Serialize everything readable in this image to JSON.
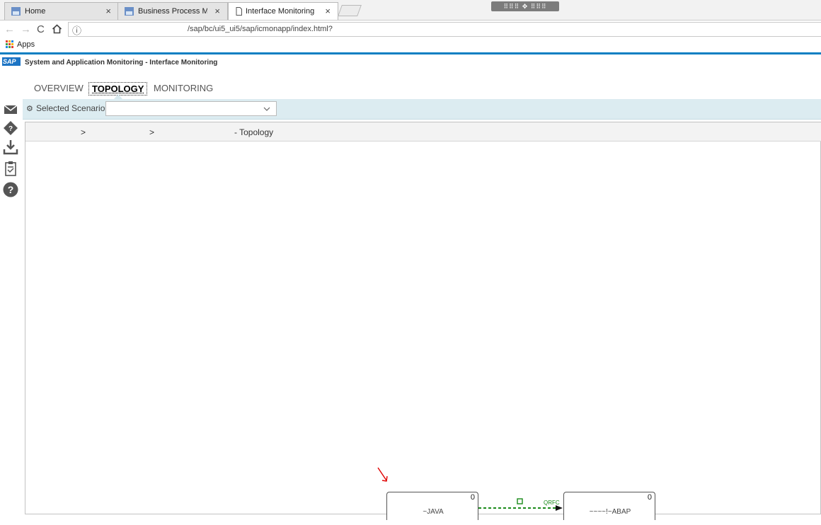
{
  "browser": {
    "tabs": [
      {
        "title": "Home",
        "close": "×"
      },
      {
        "title": "Business Process Monito",
        "close": "×"
      },
      {
        "title": "Interface Monitoring",
        "close": "×"
      }
    ],
    "window_grip": "⠿⠿⠿ ✥ ⠿⠿⠿",
    "url": "/sap/bc/ui5_ui5/sap/icmonapp/index.html?",
    "bookmarks": {
      "apps_label": "Apps"
    }
  },
  "app": {
    "logo": "SAP",
    "title": "System and Application Monitoring - Interface Monitoring",
    "tabs": [
      {
        "label": "OVERVIEW"
      },
      {
        "label": "TOPOLOGY"
      },
      {
        "label": "MONITORING"
      }
    ],
    "selected_tab": "TOPOLOGY",
    "scenario": {
      "label": "Selected Scenario",
      "value": ""
    },
    "breadcrumb": {
      "sep1": ">",
      "sep2": ">",
      "page": "- Topology"
    },
    "topology": {
      "nodes": [
        {
          "count": "0",
          "name": "~JAVA"
        },
        {
          "count": "0",
          "name": "~~~~!~ABAP"
        }
      ],
      "link": {
        "protocol": "QRFC",
        "status_color": "#1a8a1a"
      }
    }
  },
  "colors": {
    "accent": "#0a7fc2",
    "scenario_bar": "#dcecf1",
    "link_ok": "#1a8a1a",
    "annotation": "#e00000"
  }
}
